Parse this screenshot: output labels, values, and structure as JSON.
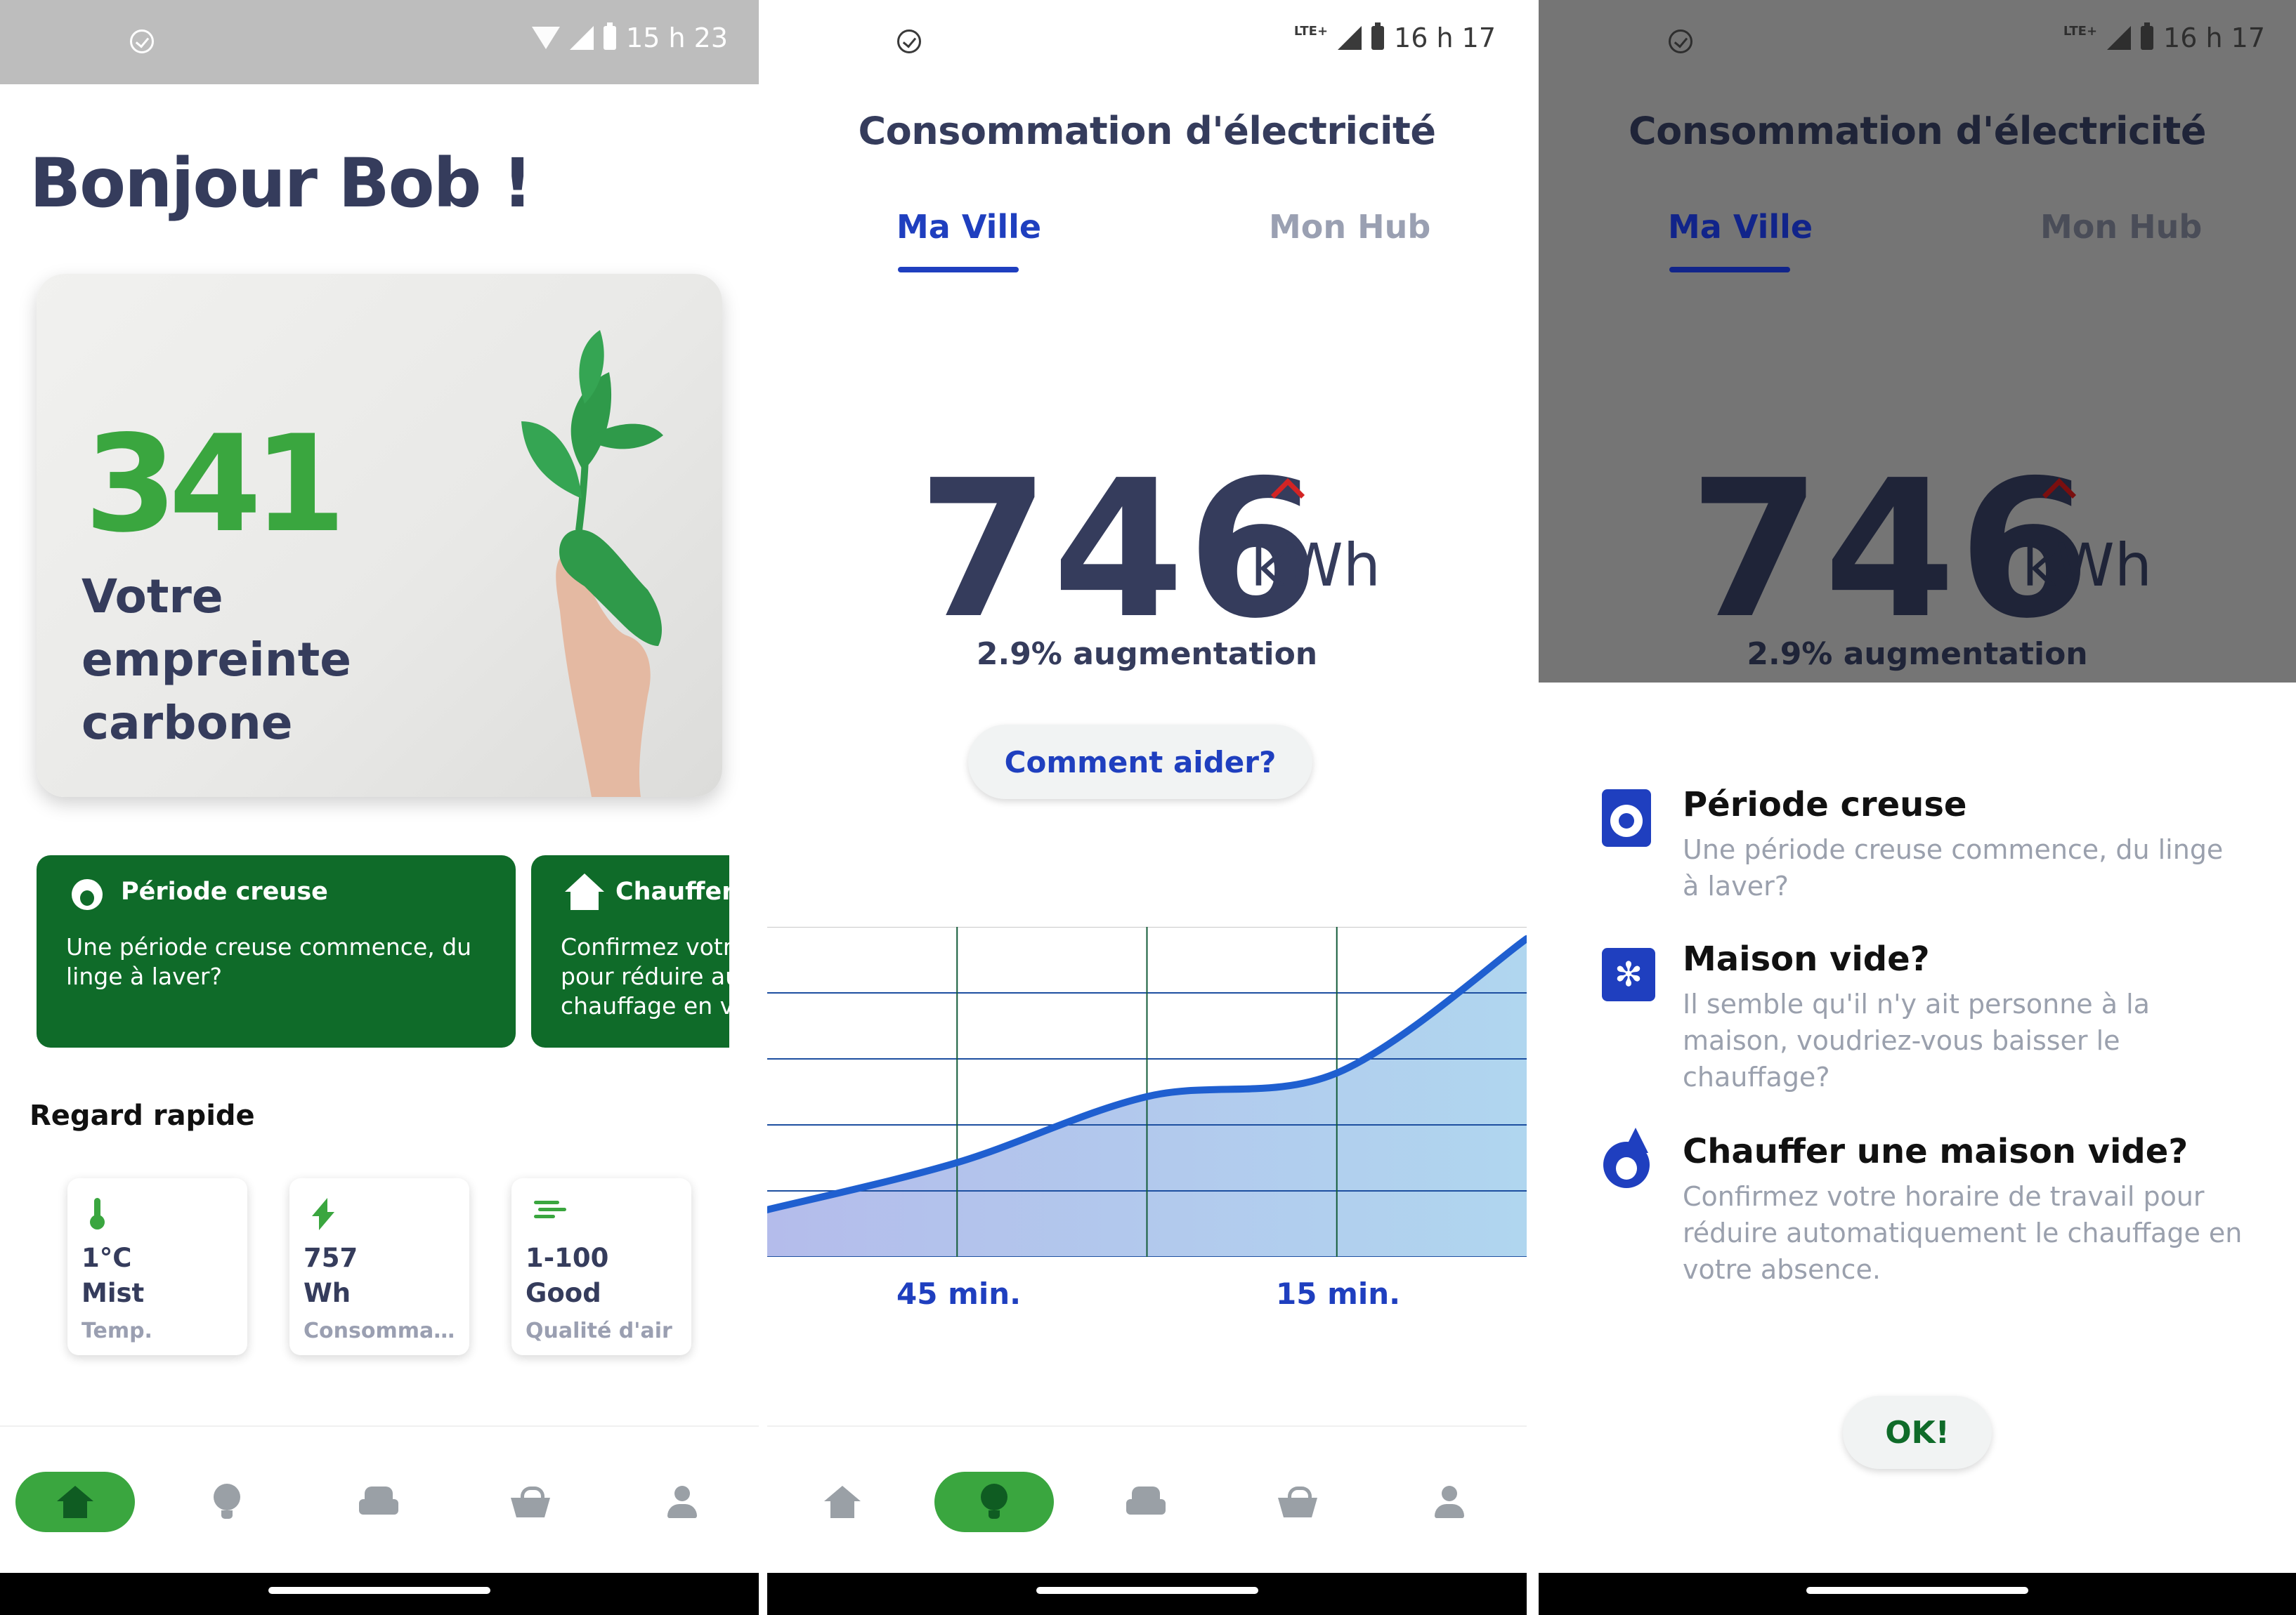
{
  "screens": {
    "home": {
      "status": {
        "time": "15 h 23"
      },
      "greeting": "Bonjour Bob !",
      "carbon": {
        "value": "341",
        "label": "Votre empreinte carbone"
      },
      "tips": [
        {
          "title": "Période creuse",
          "body": "Une période creuse commence, du linge à laver?",
          "icon": "flame-icon"
        },
        {
          "title": "Chauffer une maison vide?",
          "body": "Confirmez votre horaire de travail pour réduire automatiquement le chauffage en votre absence.",
          "icon": "house-icon"
        }
      ],
      "quick_look": {
        "title": "Regard rapide",
        "cards": [
          {
            "line1": "1°C",
            "line2": "Mist",
            "label": "Temp.",
            "icon": "thermometer-icon"
          },
          {
            "line1": "757",
            "line2": "Wh",
            "label": "Consommation",
            "icon": "bolt-icon"
          },
          {
            "line1": "1-100",
            "line2": "Good",
            "label": "Qualité d'air",
            "icon": "wind-icon"
          }
        ]
      },
      "nav_active": "home"
    },
    "electricity": {
      "status": {
        "network": "LTE+",
        "time": "16 h 17"
      },
      "title": "Consommation d'électricité",
      "tabs": [
        {
          "label": "Ma Ville",
          "active": true
        },
        {
          "label": "Mon Hub",
          "active": false
        }
      ],
      "value": "746",
      "unit": "kWh",
      "trend": "up",
      "change_text": "2.9% augmentation",
      "help_button": "Comment aider?",
      "x_labels": [
        "45 min.",
        "15 min."
      ],
      "nav_active": "tips"
    },
    "tips_dialog": {
      "status": {
        "network": "LTE+",
        "time": "16 h 17"
      },
      "items": [
        {
          "title": "Période creuse",
          "body": "Une période creuse commence, du linge à laver?",
          "icon": "washing-machine-icon"
        },
        {
          "title": "Maison vide?",
          "body": "Il semble qu'il n'y ait personne à la maison, voudriez-vous baisser le chauffage?",
          "icon": "snowflake-icon"
        },
        {
          "title": "Chauffer une maison vide?",
          "body": "Confirmez votre horaire de travail pour réduire automatiquement le chauffage en votre absence.",
          "icon": "flame-icon"
        }
      ],
      "ok_button": "OK!"
    }
  },
  "nav_items": [
    "home-icon",
    "lightbulb-icon",
    "car-icon",
    "basket-icon",
    "user-icon"
  ],
  "colors": {
    "brand_green": "#3aa63f",
    "dark_green": "#0f6b29",
    "accent_blue": "#1f3fbf",
    "text_dark": "#353c5c",
    "alert_red": "#d32424"
  },
  "chart_data": {
    "type": "area",
    "x": [
      0,
      1,
      2,
      3,
      4
    ],
    "y": [
      420,
      440,
      468,
      478,
      535
    ],
    "xlabel": "",
    "ylabel": "",
    "x_tick_labels": [
      {
        "x": 1,
        "label": "45 min."
      },
      {
        "x": 3,
        "label": "15 min."
      }
    ],
    "grid": true,
    "legend": "none"
  }
}
